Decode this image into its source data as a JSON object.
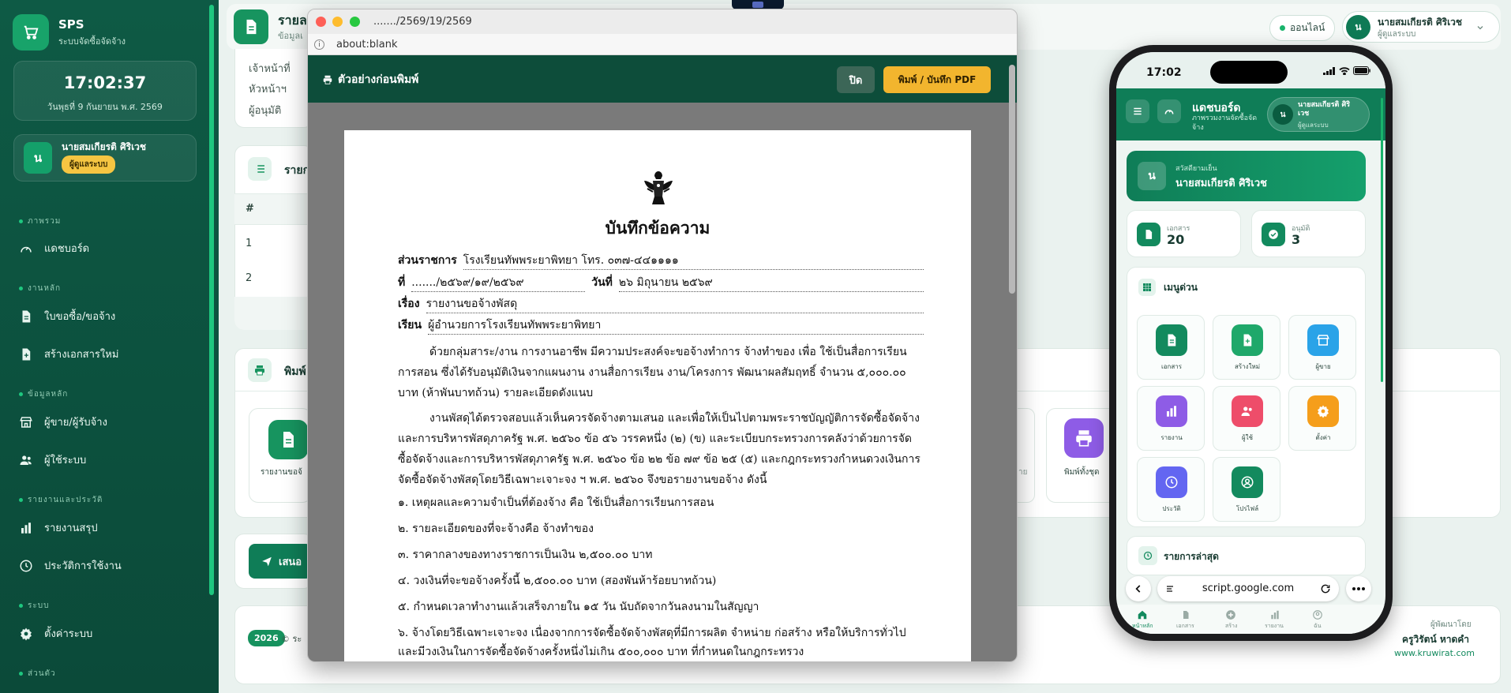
{
  "sidebar": {
    "brand_name": "SPS",
    "brand_sub": "ระบบจัดซื้อจัดจ้าง",
    "clock_time": "17:02:37",
    "clock_date": "วันพุธที่ 9 กันยายน พ.ศ. 2569",
    "user_initial": "น",
    "user_name": "นายสมเกียรติ ศิริเวช",
    "user_role": "ผู้ดูแลระบบ",
    "sections": [
      "ภาพรวม",
      "งานหลัก",
      "ข้อมูลหลัก",
      "รายงานและประวัติ",
      "ระบบ",
      "ส่วนตัว"
    ],
    "items": [
      "แดชบอร์ด",
      "ใบขอซื้อ/ขอจ้าง",
      "สร้างเอกสารใหม่",
      "ผู้ขาย/ผู้รับจ้าง",
      "ผู้ใช้ระบบ",
      "รายงานสรุป",
      "ประวัติการใช้งาน",
      "ตั้งค่าระบบ"
    ]
  },
  "topbar": {
    "title": "รายล",
    "subtitle": "ข้อมูลเ",
    "online": "ออนไลน์",
    "user_initial": "น",
    "user_name": "นายสมเกียรติ ศิริเวช",
    "user_role": "ผู้ดูแลระบบ"
  },
  "background": {
    "signers": [
      "เจ้าหน้าที่",
      "หัวหน้าฯ",
      "ผู้อนุมัติ"
    ],
    "list_title": "รายก",
    "col_no": "#",
    "rows": [
      "1",
      "2"
    ],
    "print_title": "พิมพ์",
    "doc_card_label": "รายงานขอจ้",
    "print_all_label": "พิมพ์ทั้งชุด",
    "clipped_label": "าย",
    "submit_label": "เสนอ"
  },
  "footer": {
    "year": "2026",
    "copyright": "© ระ",
    "dev_label": "ผู้พัฒนาโดย",
    "dev_name": "ครูวิรัตน์ หาดคำ",
    "dev_url": "www.kruwirat.com"
  },
  "browser": {
    "window_title": "......./2569/19/2569",
    "url": "about:blank",
    "preview_title": "ตัวอย่างก่อนพิมพ์",
    "close_label": "ปิด",
    "print_label": "พิมพ์ / บันทึก PDF"
  },
  "memo": {
    "heading": "บันทึกข้อความ",
    "agency_label": "ส่วนราชการ",
    "agency_value": "โรงเรียนทัพพระยาพิทยา โทร. ๐๓๗-๔๔๑๑๑๑",
    "no_label": "ที่",
    "no_value": "......./๒๕๖๙/๑๙/๒๕๖๙",
    "date_label": "วันที่",
    "date_value": "๒๖ มิถุนายน ๒๕๖๙",
    "subject_label": "เรื่อง",
    "subject_value": "รายงานขอจ้างพัสดุ",
    "to_label": "เรียน",
    "to_value": "ผู้อำนวยการโรงเรียนทัพพระยาพิทยา",
    "para1": "ด้วยกลุ่มสาระ/งาน การงานอาชีพ มีความประสงค์จะขอจ้างทำการ จ้างทำของ เพื่อ ใช้เป็นสื่อการเรียนการสอน ซึ่งได้รับอนุมัติเงินจากแผนงาน งานสื่อการเรียน งาน/โครงการ พัฒนาผลสัมฤทธิ์ จำนวน ๕,๐๐๐.๐๐ บาท (ห้าพันบาทถ้วน) รายละเอียดดังแนบ",
    "para2": "งานพัสดุได้ตรวจสอบแล้วเห็นควรจัดจ้างตามเสนอ และเพื่อให้เป็นไปตามพระราชบัญญัติการจัดซื้อจัดจ้างและการบริหารพัสดุภาครัฐ พ.ศ. ๒๕๖๐ ข้อ ๕๖ วรรคหนึ่ง (๒) (ข) และระเบียบกระทรวงการคลังว่าด้วยการจัดซื้อจัดจ้างและการบริหารพัสดุภาครัฐ พ.ศ. ๒๕๖๐ ข้อ ๒๒ ข้อ ๗๙ ข้อ ๒๕ (๕) และกฎกระทรวงกำหนดวงเงินการจัดซื้อจัดจ้างพัสดุโดยวิธีเฉพาะเจาะจง ฯ พ.ศ. ๒๕๖๐ จึงขอรายงานขอจ้าง ดังนี้",
    "items": [
      "๑. เหตุผลและความจำเป็นที่ต้องจ้าง คือ ใช้เป็นสื่อการเรียนการสอน",
      "๒. รายละเอียดของที่จะจ้างคือ จ้างทำของ",
      "๓. ราคากลางของทางราชการเป็นเงิน ๒,๕๐๐.๐๐ บาท",
      "๔. วงเงินที่จะขอจ้างครั้งนี้ ๒,๕๐๐.๐๐ บาท (สองพันห้าร้อยบาทถ้วน)",
      "๕. กำหนดเวลาทำงานแล้วเสร็จภายใน ๑๕ วัน นับถัดจากวันลงนามในสัญญา",
      "๖. จ้างโดยวิธีเฉพาะเจาะจง เนื่องจากการจัดซื้อจัดจ้างพัสดุที่มีการผลิต จำหน่าย ก่อสร้าง หรือให้บริการทั่วไป และมีวงเงินในการจัดซื้อจัดจ้างครั้งหนึ่งไม่เกิน ๕๐๐,๐๐๐ บาท ที่กำหนดในกฎกระทรวง"
    ]
  },
  "phone": {
    "time": "17:02",
    "header_title": "แดชบอร์ด",
    "header_sub": "ภาพรวมงานจัดซื้อจัดจ้าง",
    "user_initial": "น",
    "user_name": "นายสมเกียรติ ศิริเวช",
    "user_role": "ผู้ดูแลระบบ",
    "greeting": "สวัสดียามเย็น",
    "welcome_name": "นายสมเกียรติ ศิริเวช",
    "stat1_label": "เอกสาร",
    "stat1_value": "20",
    "stat2_label": "อนุมัติ",
    "stat2_value": "3",
    "menu_title": "เมนูด่วน",
    "menu_items": [
      "เอกสาร",
      "สร้างใหม่",
      "ผู้ขาย",
      "รายงาน",
      "ผู้ใช้",
      "ตั้งค่า",
      "ประวัติ",
      "โปรไฟล์"
    ],
    "latest_title": "รายการล่าสุด",
    "url": "script.google.com",
    "tabs": [
      "หน้าหลัก",
      "เอกสาร",
      "สร้าง",
      "รายงาน",
      "ฉัน"
    ]
  },
  "colors": {
    "sidebar": "#0e5a45",
    "accent": "#16925e",
    "print_button": "#f2b52e",
    "preview_bar": "#0d4d3a"
  }
}
